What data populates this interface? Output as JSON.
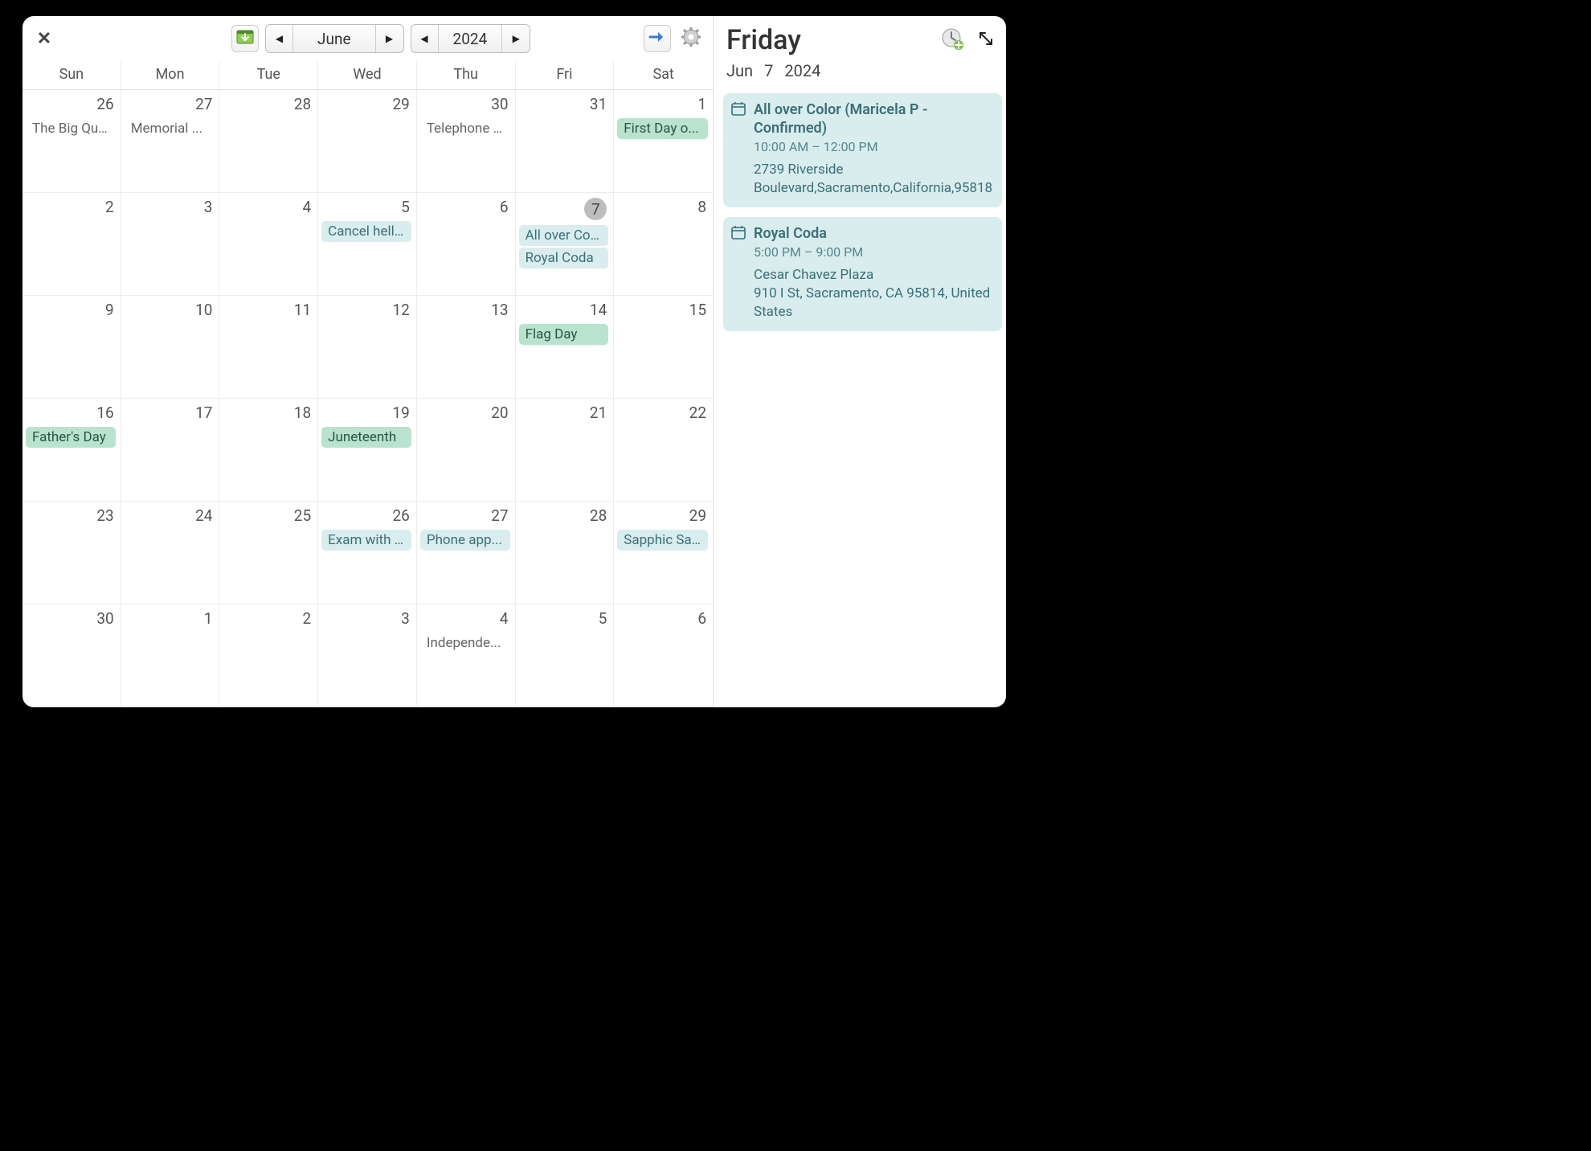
{
  "nav": {
    "month_label": "June",
    "year_label": "2024"
  },
  "dow": [
    "Sun",
    "Mon",
    "Tue",
    "Wed",
    "Thu",
    "Fri",
    "Sat"
  ],
  "cells": [
    {
      "n": "26",
      "other": true,
      "events": [
        {
          "t": "The Big Qu...",
          "k": "plain"
        }
      ]
    },
    {
      "n": "27",
      "other": true,
      "events": [
        {
          "t": "Memorial ...",
          "k": "plain"
        }
      ]
    },
    {
      "n": "28",
      "other": true,
      "events": []
    },
    {
      "n": "29",
      "other": true,
      "events": []
    },
    {
      "n": "30",
      "other": true,
      "events": [
        {
          "t": "Telephone ...",
          "k": "plain"
        }
      ]
    },
    {
      "n": "31",
      "other": true,
      "events": []
    },
    {
      "n": "1",
      "events": [
        {
          "t": "First Day o...",
          "k": "green"
        }
      ]
    },
    {
      "n": "2",
      "events": []
    },
    {
      "n": "3",
      "events": []
    },
    {
      "n": "4",
      "events": []
    },
    {
      "n": "5",
      "events": [
        {
          "t": "Cancel hell...",
          "k": "teal"
        }
      ]
    },
    {
      "n": "6",
      "events": []
    },
    {
      "n": "7",
      "selected": true,
      "events": [
        {
          "t": "All over Col...",
          "k": "teal"
        },
        {
          "t": "Royal Coda",
          "k": "teal"
        }
      ]
    },
    {
      "n": "8",
      "events": []
    },
    {
      "n": "9",
      "events": []
    },
    {
      "n": "10",
      "events": []
    },
    {
      "n": "11",
      "events": []
    },
    {
      "n": "12",
      "events": []
    },
    {
      "n": "13",
      "events": []
    },
    {
      "n": "14",
      "events": [
        {
          "t": "Flag Day",
          "k": "green"
        }
      ]
    },
    {
      "n": "15",
      "events": []
    },
    {
      "n": "16",
      "events": [
        {
          "t": "Father's Day",
          "k": "green"
        }
      ]
    },
    {
      "n": "17",
      "events": []
    },
    {
      "n": "18",
      "events": []
    },
    {
      "n": "19",
      "events": [
        {
          "t": "Juneteenth",
          "k": "green"
        }
      ]
    },
    {
      "n": "20",
      "events": []
    },
    {
      "n": "21",
      "events": []
    },
    {
      "n": "22",
      "events": []
    },
    {
      "n": "23",
      "events": []
    },
    {
      "n": "24",
      "events": []
    },
    {
      "n": "25",
      "events": []
    },
    {
      "n": "26",
      "events": [
        {
          "t": "Exam with ...",
          "k": "teal"
        }
      ]
    },
    {
      "n": "27",
      "events": [
        {
          "t": "Phone app...",
          "k": "teal"
        }
      ]
    },
    {
      "n": "28",
      "events": []
    },
    {
      "n": "29",
      "events": [
        {
          "t": "Sapphic Sa...",
          "k": "teal"
        }
      ]
    },
    {
      "n": "30",
      "events": []
    },
    {
      "n": "1",
      "other": true,
      "events": []
    },
    {
      "n": "2",
      "other": true,
      "events": []
    },
    {
      "n": "3",
      "other": true,
      "events": []
    },
    {
      "n": "4",
      "other": true,
      "events": [
        {
          "t": "Independe...",
          "k": "plain"
        }
      ]
    },
    {
      "n": "5",
      "other": true,
      "events": []
    },
    {
      "n": "6",
      "other": true,
      "events": []
    }
  ],
  "side": {
    "dow": "Friday",
    "date_month": "Jun",
    "date_day": "7",
    "date_year": "2024",
    "items": [
      {
        "title": "All over Color (Maricela P - Confirmed)",
        "time": "10:00 AM – 12:00 PM",
        "loc": "2739 Riverside Boulevard,Sacramento,California,95818"
      },
      {
        "title": "Royal Coda",
        "time": "5:00 PM – 9:00 PM",
        "loc": "Cesar Chavez Plaza\n910 I St, Sacramento, CA  95814, United States"
      }
    ]
  }
}
